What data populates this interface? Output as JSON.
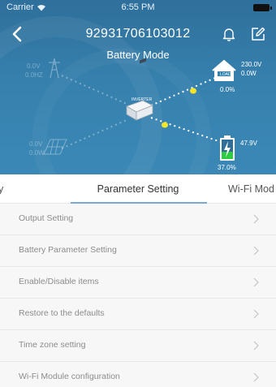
{
  "status_bar": {
    "carrier": "Carrier",
    "time": "6:55 PM"
  },
  "header": {
    "title": "92931706103012",
    "mode": "Battery Mode"
  },
  "diagram": {
    "grid": {
      "voltage": "0.0V",
      "frequency": "0.0HZ"
    },
    "pv": {
      "voltage": "0.0V",
      "power": "0.0W"
    },
    "inverter_label": "INVERTER",
    "load": {
      "label": "LOAD",
      "voltage": "230.0V",
      "power": "0.0W",
      "percent": "0.0%"
    },
    "battery": {
      "voltage": "47.9V",
      "percent": "37.0%",
      "level": 0.37
    }
  },
  "tabs": [
    {
      "label": "y"
    },
    {
      "label": "Parameter Setting"
    },
    {
      "label": "Wi-Fi Mod"
    }
  ],
  "menu": {
    "items": [
      {
        "label": "Output Setting"
      },
      {
        "label": "Battery Parameter Setting"
      },
      {
        "label": "Enable/Disable items"
      },
      {
        "label": "Restore to the defaults"
      },
      {
        "label": "Time zone setting"
      },
      {
        "label": "Wi-Fi Module configuration"
      }
    ]
  },
  "colors": {
    "header_bg": "#3680ad",
    "battery_fill": "#2ecc40",
    "flow_dot": "#f5e625",
    "tab_indicator": "#7aa9cf"
  },
  "icons": [
    "wifi-icon",
    "back-icon",
    "bell-icon",
    "edit-icon",
    "grid-tower-icon",
    "solar-panel-icon",
    "inverter-icon",
    "house-load-icon",
    "battery-charging-icon",
    "chevron-right-icon"
  ]
}
